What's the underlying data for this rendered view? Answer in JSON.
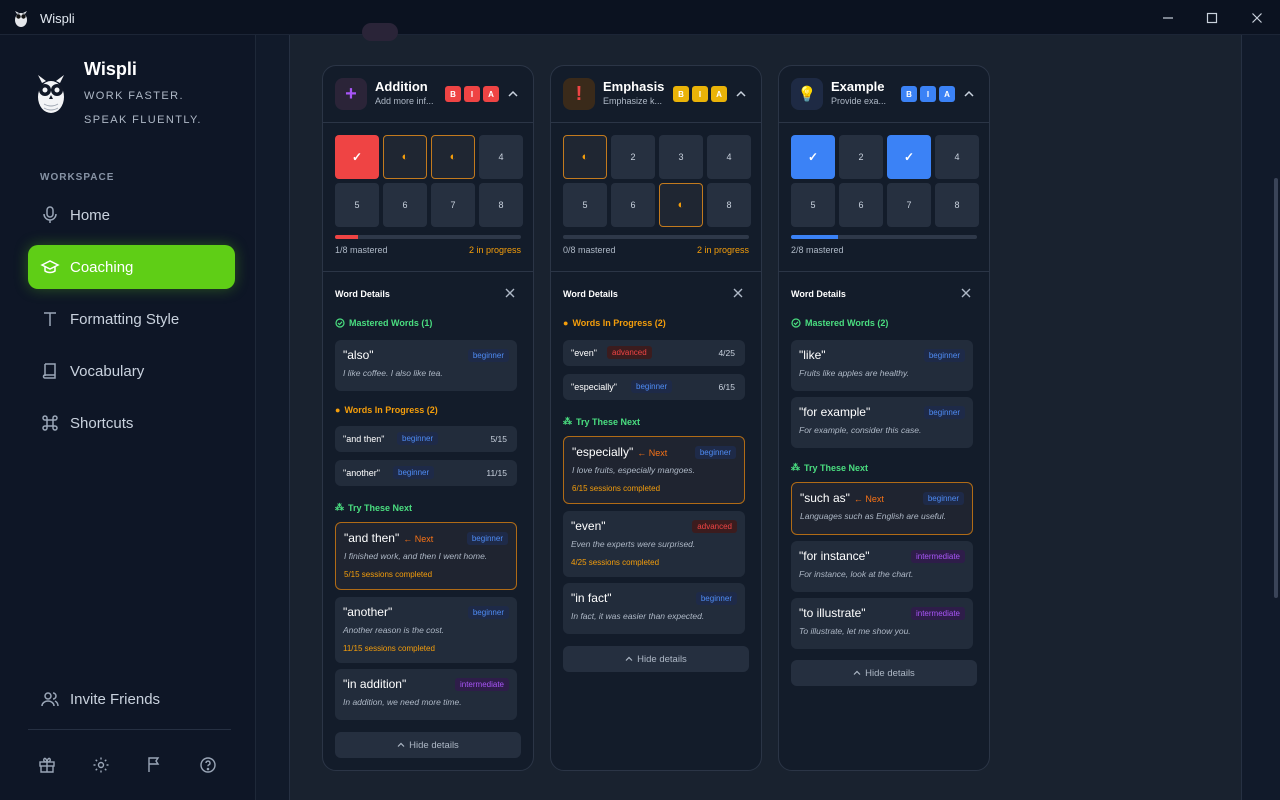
{
  "app": {
    "title": "Wispli",
    "brand_name": "Wispli",
    "tagline1": "WORK FASTER.",
    "tagline2": "SPEAK FLUENTLY."
  },
  "sidebar": {
    "section": "WORKSPACE",
    "items": [
      {
        "label": "Home",
        "icon": "microphone-icon"
      },
      {
        "label": "Coaching",
        "icon": "graduation-cap-icon",
        "active": true
      },
      {
        "label": "Formatting Style",
        "icon": "text-icon"
      },
      {
        "label": "Vocabulary",
        "icon": "book-icon"
      },
      {
        "label": "Shortcuts",
        "icon": "command-icon"
      }
    ],
    "invite": "Invite Friends",
    "footer_icons": [
      "gift-icon",
      "settings-icon",
      "flag-icon",
      "help-icon"
    ]
  },
  "colors": {
    "accent": "#5fce16",
    "red": "#ef4444",
    "yellow": "#eab308",
    "blue": "#3b82f6",
    "orange": "#f59e0b",
    "green": "#4ade80"
  },
  "common": {
    "word_details": "Word Details",
    "hide_details": "Hide details",
    "next": "← Next",
    "mastered": "✓",
    "in_progress_glyph": "◐",
    "sessions_suffix": "sessions completed"
  },
  "cards": [
    {
      "title": "Addition",
      "subtitle": "Add more inf...",
      "icon": "+",
      "badges": [
        "B",
        "I",
        "A"
      ],
      "cells": [
        "✓",
        "◐",
        "◐",
        "4",
        "5",
        "6",
        "7",
        "8"
      ],
      "progress_fraction": 0.125,
      "mastered_text": "1/8 mastered",
      "in_progress_text": "2 in progress",
      "mastered_label": "Mastered Words (1)",
      "mastered_words": [
        {
          "word": "\"also\"",
          "level": "beginner",
          "example": "I like coffee. I also like tea."
        }
      ],
      "progress_label": "Words In Progress (2)",
      "progress_words": [
        {
          "word": "\"and then\"",
          "level": "beginner",
          "count": "5/15"
        },
        {
          "word": "\"another\"",
          "level": "beginner",
          "count": "11/15"
        }
      ],
      "try_label": "Try These Next",
      "try_words": [
        {
          "word": "\"and then\"",
          "level": "beginner",
          "example": "I finished work, and then I went home.",
          "sessions": "5/15 sessions completed"
        },
        {
          "word": "\"another\"",
          "level": "beginner",
          "example": "Another reason is the cost.",
          "sessions": "11/15 sessions completed"
        },
        {
          "word": "\"in addition\"",
          "level": "intermediate",
          "example": "In addition, we need more time."
        }
      ]
    },
    {
      "title": "Emphasis",
      "subtitle": "Emphasize k...",
      "icon": "!",
      "badges": [
        "B",
        "I",
        "A"
      ],
      "cells": [
        "◐",
        "2",
        "3",
        "4",
        "5",
        "6",
        "◐",
        "8"
      ],
      "progress_fraction": 0,
      "mastered_text": "0/8 mastered",
      "in_progress_text": "2 in progress",
      "progress_label": "Words In Progress (2)",
      "progress_words": [
        {
          "word": "\"even\"",
          "level": "advanced",
          "count": "4/25"
        },
        {
          "word": "\"especially\"",
          "level": "beginner",
          "count": "6/15"
        }
      ],
      "try_label": "Try These Next",
      "try_words": [
        {
          "word": "\"especially\"",
          "level": "beginner",
          "example": "I love fruits, especially mangoes.",
          "sessions": "6/15 sessions completed"
        },
        {
          "word": "\"even\"",
          "level": "advanced",
          "example": "Even the experts were surprised.",
          "sessions": "4/25 sessions completed"
        },
        {
          "word": "\"in fact\"",
          "level": "beginner",
          "example": "In fact, it was easier than expected."
        }
      ]
    },
    {
      "title": "Example",
      "subtitle": "Provide exa...",
      "icon": "💡",
      "badges": [
        "B",
        "I",
        "A"
      ],
      "cells": [
        "✓",
        "2",
        "✓",
        "4",
        "5",
        "6",
        "7",
        "8"
      ],
      "progress_fraction": 0.25,
      "mastered_text": "2/8 mastered",
      "mastered_label": "Mastered Words (2)",
      "mastered_words": [
        {
          "word": "\"like\"",
          "level": "beginner",
          "example": "Fruits like apples are healthy."
        },
        {
          "word": "\"for example\"",
          "level": "beginner",
          "example": "For example, consider this case."
        }
      ],
      "try_label": "Try These Next",
      "try_words": [
        {
          "word": "\"such as\"",
          "level": "beginner",
          "example": "Languages such as English are useful."
        },
        {
          "word": "\"for instance\"",
          "level": "intermediate",
          "example": "For instance, look at the chart."
        },
        {
          "word": "\"to illustrate\"",
          "level": "intermediate",
          "example": "To illustrate, let me show you."
        }
      ]
    }
  ]
}
